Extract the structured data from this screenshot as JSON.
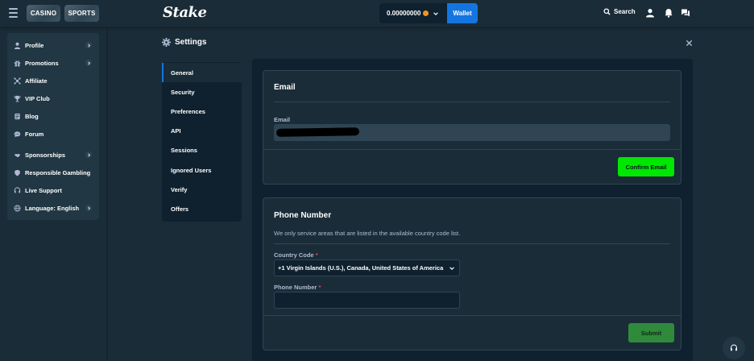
{
  "topbar": {
    "casino_label": "CASINO",
    "sports_label": "SPORTS",
    "logo": "Stake",
    "balance": "0.00000000",
    "wallet_label": "Wallet",
    "search_label": "Search",
    "icons": [
      "user-icon",
      "bell-icon",
      "chat-icon"
    ]
  },
  "nav": {
    "group1": [
      {
        "label": "Profile",
        "icon": "user-icon",
        "has_arrow": true
      },
      {
        "label": "Promotions",
        "icon": "gift-icon",
        "has_arrow": true
      },
      {
        "label": "Affiliate",
        "icon": "affiliate-icon",
        "has_arrow": false
      },
      {
        "label": "VIP Club",
        "icon": "trophy-icon",
        "has_arrow": false
      },
      {
        "label": "Blog",
        "icon": "blog-icon",
        "has_arrow": false
      },
      {
        "label": "Forum",
        "icon": "forum-icon",
        "has_arrow": false
      }
    ],
    "group2": [
      {
        "label": "Sponsorships",
        "icon": "sponsorship-icon",
        "has_arrow": true
      },
      {
        "label": "Responsible Gambling",
        "icon": "shield-icon",
        "has_arrow": false
      },
      {
        "label": "Live Support",
        "icon": "headset-icon",
        "has_arrow": false
      },
      {
        "label": "Language: English",
        "icon": "globe-icon",
        "has_arrow": true
      }
    ]
  },
  "settings": {
    "title": "Settings",
    "tabs": [
      "General",
      "Security",
      "Preferences",
      "API",
      "Sessions",
      "Ignored Users",
      "Verify",
      "Offers"
    ],
    "active_tab": "General"
  },
  "email_card": {
    "title": "Email",
    "field_label": "Email",
    "button_label": "Confirm Email"
  },
  "phone_card": {
    "title": "Phone Number",
    "hint": "We only service areas that are listed in the available country code list.",
    "country_label": "Country Code",
    "country_value": "+1 Virgin Islands (U.S.), Canada, United States of America",
    "phone_label": "Phone Number",
    "phone_value": "",
    "required_mark": "*",
    "button_label": "Submit"
  },
  "colors": {
    "background": "#1a2c38",
    "panel": "#0f212e",
    "accent_blue": "#1475e1",
    "accent_green": "#00e701",
    "muted_text": "#b1bad3"
  }
}
